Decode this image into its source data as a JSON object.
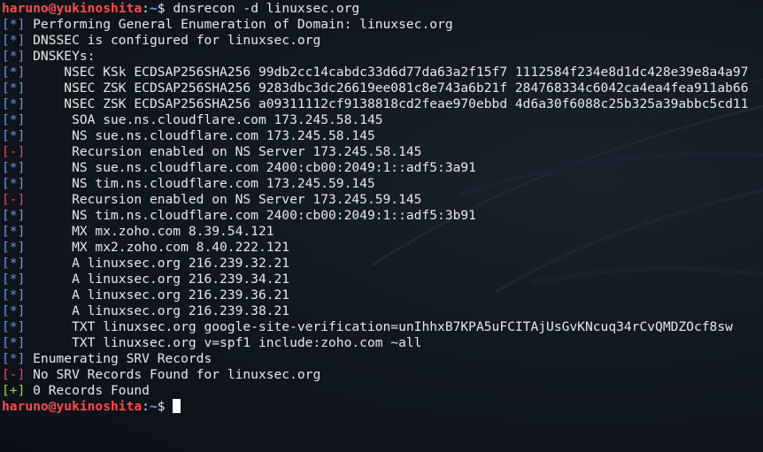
{
  "prompt": {
    "user_host": "haruno@yukinoshita",
    "sep": ":",
    "path": "~",
    "symbol": "$ ",
    "command": "dnsrecon -d linuxsec.org"
  },
  "colors": {
    "info_tag": "#5a9bff",
    "error_tag": "#ff4444",
    "ok_tag": "#8ae234",
    "user_host": "#ff4b4b",
    "path": "#5fa8ff"
  },
  "output": [
    {
      "tag": "[*]",
      "kind": "info",
      "text": " Performing General Enumeration of Domain: linuxsec.org"
    },
    {
      "tag": "[*]",
      "kind": "info",
      "text": " DNSSEC is configured for linuxsec.org"
    },
    {
      "tag": "[*]",
      "kind": "info",
      "text": " DNSKEYs:"
    },
    {
      "tag": "[*]",
      "kind": "info",
      "text": "     NSEC KSk ECDSAP256SHA256 99db2cc14cabdc33d6d77da63a2f15f7 1112584f234e8d1dc428e39e8a4a97"
    },
    {
      "tag": "[*]",
      "kind": "info",
      "text": "     NSEC ZSK ECDSAP256SHA256 9283dbc3dc26619ee081c8e743a6b21f 284768334c6042ca4ea4fea911ab66"
    },
    {
      "tag": "[*]",
      "kind": "info",
      "text": "     NSEC ZSK ECDSAP256SHA256 a09311112cf9138818cd2feae970ebbd 4d6a30f6088c25b325a39abbc5cd11"
    },
    {
      "tag": "[*]",
      "kind": "info",
      "text": "      SOA sue.ns.cloudflare.com 173.245.58.145"
    },
    {
      "tag": "[*]",
      "kind": "info",
      "text": "      NS sue.ns.cloudflare.com 173.245.58.145"
    },
    {
      "tag": "[-]",
      "kind": "error",
      "text": "      Recursion enabled on NS Server 173.245.58.145"
    },
    {
      "tag": "[*]",
      "kind": "info",
      "text": "      NS sue.ns.cloudflare.com 2400:cb00:2049:1::adf5:3a91"
    },
    {
      "tag": "[*]",
      "kind": "info",
      "text": "      NS tim.ns.cloudflare.com 173.245.59.145"
    },
    {
      "tag": "[-]",
      "kind": "error",
      "text": "      Recursion enabled on NS Server 173.245.59.145"
    },
    {
      "tag": "[*]",
      "kind": "info",
      "text": "      NS tim.ns.cloudflare.com 2400:cb00:2049:1::adf5:3b91"
    },
    {
      "tag": "[*]",
      "kind": "info",
      "text": "      MX mx.zoho.com 8.39.54.121"
    },
    {
      "tag": "[*]",
      "kind": "info",
      "text": "      MX mx2.zoho.com 8.40.222.121"
    },
    {
      "tag": "[*]",
      "kind": "info",
      "text": "      A linuxsec.org 216.239.32.21"
    },
    {
      "tag": "[*]",
      "kind": "info",
      "text": "      A linuxsec.org 216.239.34.21"
    },
    {
      "tag": "[*]",
      "kind": "info",
      "text": "      A linuxsec.org 216.239.36.21"
    },
    {
      "tag": "[*]",
      "kind": "info",
      "text": "      A linuxsec.org 216.239.38.21"
    },
    {
      "tag": "[*]",
      "kind": "info",
      "text": "      TXT linuxsec.org google-site-verification=unIhhxB7KPA5uFCITAjUsGvKNcuq34rCvQMDZOcf8sw"
    },
    {
      "tag": "[*]",
      "kind": "info",
      "text": "      TXT linuxsec.org v=spf1 include:zoho.com ~all"
    },
    {
      "tag": "[*]",
      "kind": "info",
      "text": " Enumerating SRV Records"
    },
    {
      "tag": "[-]",
      "kind": "error",
      "text": " No SRV Records Found for linuxsec.org"
    },
    {
      "tag": "[+]",
      "kind": "ok",
      "text": " 0 Records Found"
    }
  ]
}
